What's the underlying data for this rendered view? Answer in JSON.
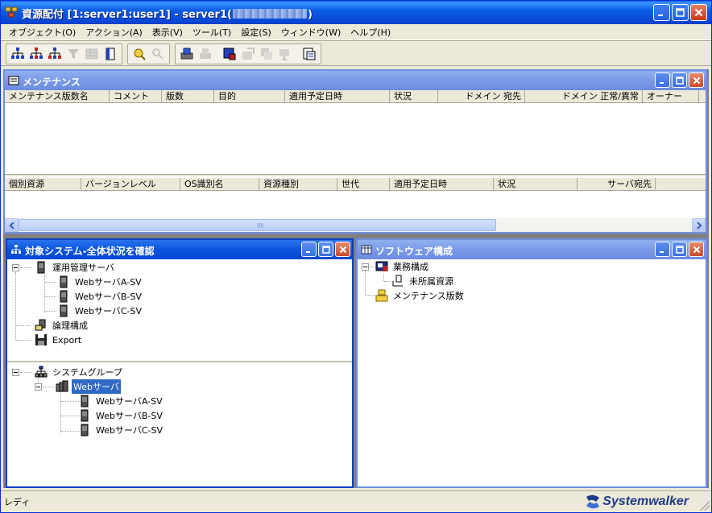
{
  "window": {
    "title_prefix": "資源配付 [1:server1:user1]  - server1(",
    "title_suffix": ")"
  },
  "menu": [
    "オブジェクト(O)",
    "アクション(A)",
    "表示(V)",
    "ツール(T)",
    "設定(S)",
    "ウィンドウ(W)",
    "ヘルプ(H)"
  ],
  "toolbar": {
    "icons": [
      "tree-view-icon",
      "tree-red-icon",
      "tree-alt-icon",
      "filter-icon",
      "grid-icon",
      "document-icon",
      "edit-pen-icon",
      "search-icon",
      "transfer-icon",
      "transfer-alt-icon",
      "window-blue-icon",
      "apply-icon",
      "copy-icon",
      "stamp-icon",
      "properties-icon"
    ]
  },
  "maintenance_window": {
    "title": "メンテナンス",
    "upper_columns": [
      "メンテナンス版数名",
      "コメント",
      "版数",
      "目的",
      "適用予定日時",
      "状況",
      "ドメイン 宛先",
      "ドメイン 正常/異常",
      "オーナー"
    ],
    "lower_columns": [
      "個別資源",
      "バージョンレベル",
      "OS識別名",
      "資源種別",
      "世代",
      "適用予定日時",
      "状況",
      "サーバ宛先"
    ]
  },
  "system_window": {
    "title": "対象システム-全体状況を確認",
    "tree_top": {
      "root": "運用管理サーバ",
      "servers": [
        "WebサーバA-SV",
        "WebサーバB-SV",
        "WebサーバC-SV"
      ],
      "logical": "論理構成",
      "export": "Export"
    },
    "tree_bottom": {
      "root": "システムグループ",
      "group": "Webサーバ",
      "servers": [
        "WebサーバA-SV",
        "WebサーバB-SV",
        "WebサーバC-SV"
      ]
    }
  },
  "software_window": {
    "title": "ソフトウェア構成",
    "tree": {
      "root": "業務構成",
      "child": "未所属資源",
      "maintenance": "メンテナンス版数"
    }
  },
  "status": {
    "text": "レディ",
    "brand": "Systemwalker"
  },
  "colors": {
    "titlebar": "#0a55de",
    "inactive_title": "#7b9be6",
    "selection": "#316ac5",
    "face": "#ece9d8"
  }
}
